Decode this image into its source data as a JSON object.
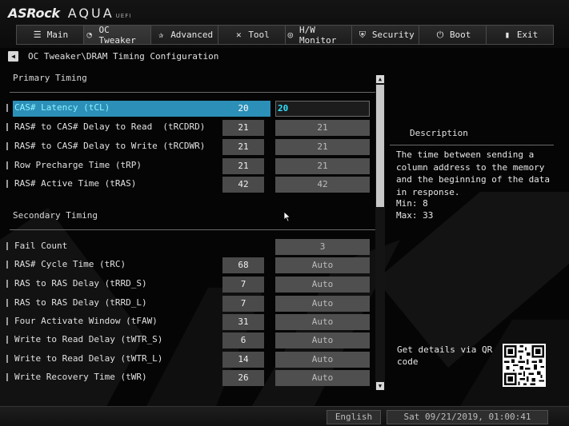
{
  "brand": {
    "name": "ASRock",
    "product": "AQUA",
    "suffix": "UEFI"
  },
  "tabs": [
    {
      "label": "Main",
      "icon": "list-icon"
    },
    {
      "label": "OC Tweaker",
      "icon": "oc-icon",
      "active": true
    },
    {
      "label": "Advanced",
      "icon": "star-icon"
    },
    {
      "label": "Tool",
      "icon": "tools-icon"
    },
    {
      "label": "H/W Monitor",
      "icon": "monitor-icon"
    },
    {
      "label": "Security",
      "icon": "shield-icon"
    },
    {
      "label": "Boot",
      "icon": "power-icon"
    },
    {
      "label": "Exit",
      "icon": "exit-icon"
    }
  ],
  "breadcrumb": "OC Tweaker\\DRAM Timing Configuration",
  "primary": {
    "title": "Primary Timing",
    "rows": [
      {
        "label": "CAS# Latency (tCL)",
        "current": "20",
        "setting": "20"
      },
      {
        "label": "RAS# to CAS# Delay to Read  (tRCDRD)",
        "current": "21",
        "setting": "21"
      },
      {
        "label": "RAS# to CAS# Delay to Write (tRCDWR)",
        "current": "21",
        "setting": "21"
      },
      {
        "label": "Row Precharge Time (tRP)",
        "current": "21",
        "setting": "21"
      },
      {
        "label": "RAS# Active Time (tRAS)",
        "current": "42",
        "setting": "42"
      }
    ]
  },
  "secondary": {
    "title": "Secondary Timing",
    "rows": [
      {
        "label": "Fail Count",
        "current": "",
        "setting": "3"
      },
      {
        "label": "RAS# Cycle Time (tRC)",
        "current": "68",
        "setting": "Auto"
      },
      {
        "label": "RAS to RAS Delay (tRRD_S)",
        "current": "7",
        "setting": "Auto"
      },
      {
        "label": "RAS to RAS Delay (tRRD_L)",
        "current": "7",
        "setting": "Auto"
      },
      {
        "label": "Four Activate Window (tFAW)",
        "current": "31",
        "setting": "Auto"
      },
      {
        "label": "Write to Read Delay (tWTR_S)",
        "current": "6",
        "setting": "Auto"
      },
      {
        "label": "Write to Read Delay (tWTR_L)",
        "current": "14",
        "setting": "Auto"
      },
      {
        "label": "Write Recovery Time (tWR)",
        "current": "26",
        "setting": "Auto"
      }
    ]
  },
  "description": {
    "title": "Description",
    "text": "The time between sending a column address to the memory and the beginning of the data in response.",
    "min": "Min: 8",
    "max": "Max: 33"
  },
  "qr_text": "Get details via QR code",
  "footer": {
    "language": "English",
    "datetime": "Sat 09/21/2019, 01:00:41"
  },
  "colors": {
    "highlight": "#2b8fb8",
    "selected_value": "#2ee0ff"
  }
}
